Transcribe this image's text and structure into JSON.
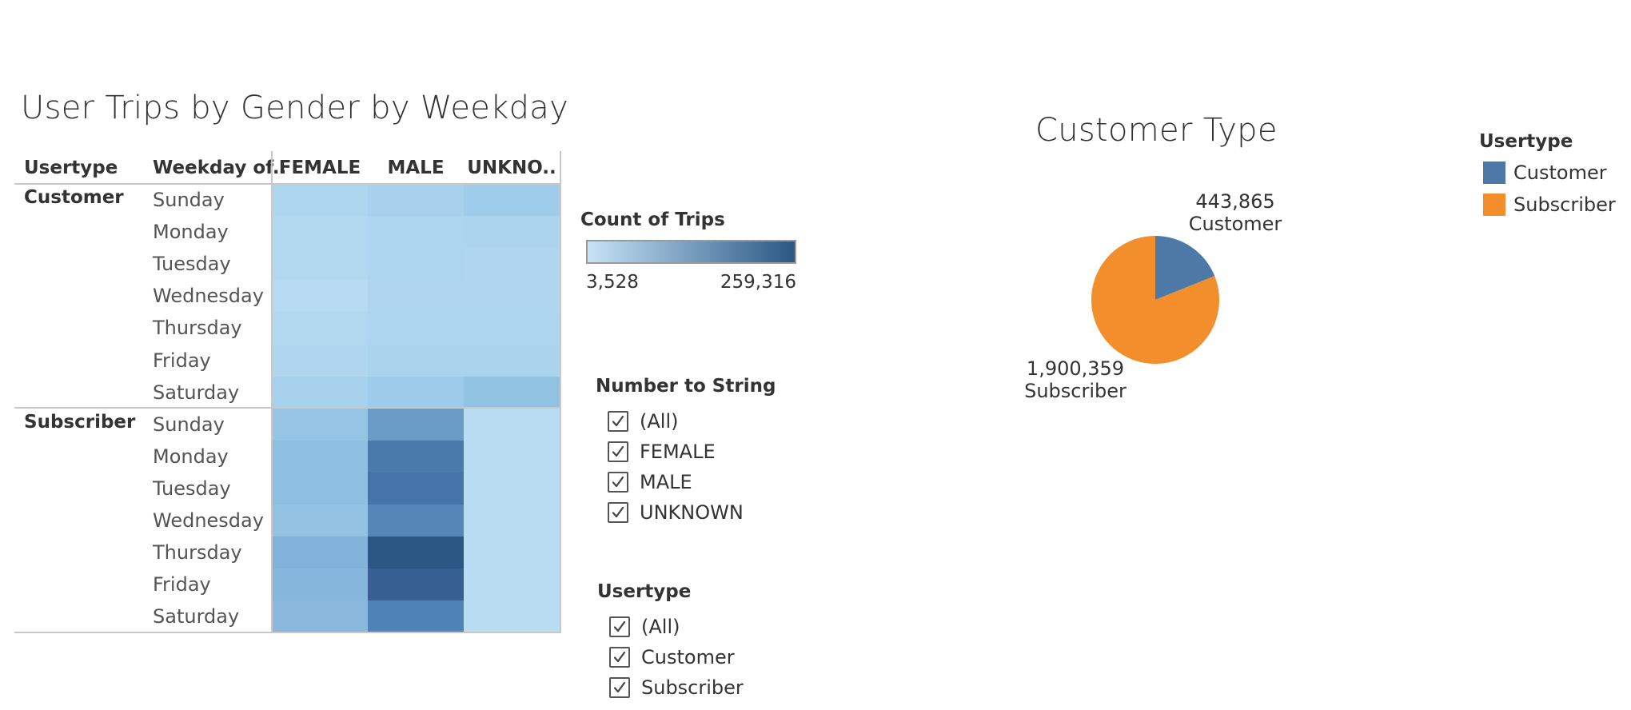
{
  "heatmap": {
    "title": "User Trips by Gender by Weekday",
    "col_headers": {
      "usertype": "Usertype",
      "weekday": "Weekday of..",
      "female": "FEMALE",
      "male": "MALE",
      "unknown": "UNKNO.."
    },
    "groups": [
      {
        "name": "Customer",
        "rows": [
          {
            "day": "Sunday",
            "colors": [
              "#acd5ee",
              "#a7d1ed",
              "#9fccea"
            ]
          },
          {
            "day": "Monday",
            "colors": [
              "#b2d8f0",
              "#aed5ef",
              "#acd4ef"
            ]
          },
          {
            "day": "Tuesday",
            "colors": [
              "#b2d8f0",
              "#aed5ef",
              "#b0d6ef"
            ]
          },
          {
            "day": "Wednesday",
            "colors": [
              "#b5daf1",
              "#b0d6ef",
              "#b0d6ef"
            ]
          },
          {
            "day": "Thursday",
            "colors": [
              "#b2d8f0",
              "#aed5ef",
              "#aed5ef"
            ]
          },
          {
            "day": "Friday",
            "colors": [
              "#b0d6ef",
              "#aad3ee",
              "#aad3ee"
            ]
          },
          {
            "day": "Saturday",
            "colors": [
              "#a8d1ed",
              "#9ecbea",
              "#92c2e1"
            ]
          }
        ]
      },
      {
        "name": "Subscriber",
        "rows": [
          {
            "day": "Sunday",
            "colors": [
              "#96c4e4",
              "#6a9cc7",
              "#b8dcf2"
            ]
          },
          {
            "day": "Monday",
            "colors": [
              "#8ebee0",
              "#4a79ac",
              "#b8dcf2"
            ]
          },
          {
            "day": "Tuesday",
            "colors": [
              "#8ebee0",
              "#4774a8",
              "#b8dcf2"
            ]
          },
          {
            "day": "Wednesday",
            "colors": [
              "#93c2e2",
              "#5586b7",
              "#b8dcf2"
            ]
          },
          {
            "day": "Thursday",
            "colors": [
              "#82b2d9",
              "#2c5785",
              "#b8dcf2"
            ]
          },
          {
            "day": "Friday",
            "colors": [
              "#86b6db",
              "#375f92",
              "#b8dcf2"
            ]
          },
          {
            "day": "Saturday",
            "colors": [
              "#8ab8dd",
              "#5083b5",
              "#b8dcf2"
            ]
          }
        ]
      }
    ]
  },
  "color_legend": {
    "title": "Count of Trips",
    "min_label": "3,528",
    "max_label": "259,316",
    "min_color": "#c6e3f7",
    "max_color": "#2a5783"
  },
  "filter_gender": {
    "title": "Number to String",
    "options": [
      "(All)",
      "FEMALE",
      "MALE",
      "UNKNOWN"
    ]
  },
  "filter_usertype": {
    "title": "Usertype",
    "options": [
      "(All)",
      "Customer",
      "Subscriber"
    ]
  },
  "pie": {
    "title": "Customer Type",
    "legend_title": "Usertype",
    "slices": [
      {
        "label": "Customer",
        "value": "443,865",
        "color": "#4e79a7"
      },
      {
        "label": "Subscriber",
        "value": "1,900,359",
        "color": "#f28e2b"
      }
    ]
  },
  "chart_data": [
    {
      "type": "heatmap",
      "title": "User Trips by Gender by Weekday",
      "row_dimensions": [
        "Usertype",
        "Weekday of.."
      ],
      "columns": [
        "FEMALE",
        "MALE",
        "UNKNO.."
      ],
      "color_measure": "Count of Trips",
      "color_range": [
        3528,
        259316
      ],
      "rows": [
        {
          "usertype": "Customer",
          "weekday": "Sunday"
        },
        {
          "usertype": "Customer",
          "weekday": "Monday"
        },
        {
          "usertype": "Customer",
          "weekday": "Tuesday"
        },
        {
          "usertype": "Customer",
          "weekday": "Wednesday"
        },
        {
          "usertype": "Customer",
          "weekday": "Thursday"
        },
        {
          "usertype": "Customer",
          "weekday": "Friday"
        },
        {
          "usertype": "Customer",
          "weekday": "Saturday"
        },
        {
          "usertype": "Subscriber",
          "weekday": "Sunday"
        },
        {
          "usertype": "Subscriber",
          "weekday": "Monday"
        },
        {
          "usertype": "Subscriber",
          "weekday": "Tuesday"
        },
        {
          "usertype": "Subscriber",
          "weekday": "Wednesday"
        },
        {
          "usertype": "Subscriber",
          "weekday": "Thursday"
        },
        {
          "usertype": "Subscriber",
          "weekday": "Friday"
        },
        {
          "usertype": "Subscriber",
          "weekday": "Saturday"
        }
      ]
    },
    {
      "type": "pie",
      "title": "Customer Type",
      "legend": "Usertype",
      "categories": [
        "Customer",
        "Subscriber"
      ],
      "values": [
        443865,
        1900359
      ]
    }
  ]
}
